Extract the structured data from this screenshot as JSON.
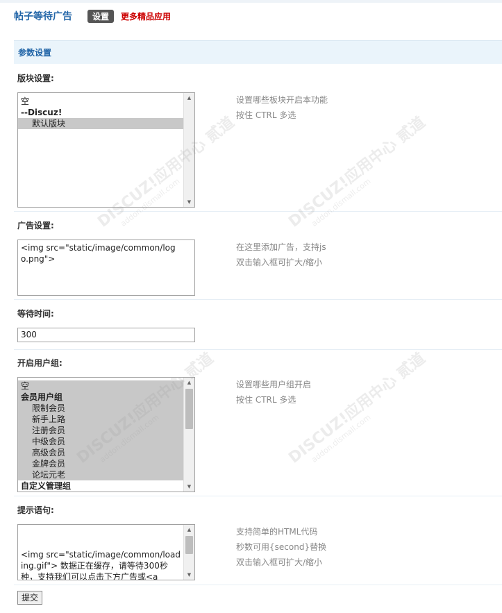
{
  "header": {
    "app_title": "帖子等待广告",
    "settings_tab": "设置",
    "more_apps_link": "更多精品应用"
  },
  "section": {
    "title": "参数设置"
  },
  "forum_setting": {
    "label": "版块设置:",
    "options": [
      {
        "text": "空",
        "type": "plain",
        "selected": false
      },
      {
        "text": "--Discuz!",
        "type": "group",
        "selected": false
      },
      {
        "text": "默认版块",
        "type": "indent",
        "selected": true
      }
    ],
    "tip_line1": "设置哪些板块开启本功能",
    "tip_line2": "按住 CTRL 多选"
  },
  "ad_setting": {
    "label": "广告设置:",
    "value": "<img src=\"static/image/common/logo.png\">",
    "tip_line1": "在这里添加广告，支持js",
    "tip_line2": "双击输入框可扩大/缩小"
  },
  "wait_time": {
    "label": "等待时间:",
    "value": "300"
  },
  "user_groups": {
    "label": "开启用户组:",
    "options": [
      {
        "text": "空",
        "type": "plain",
        "selected": true
      },
      {
        "text": "会员用户组",
        "type": "group",
        "selected": true
      },
      {
        "text": "限制会员",
        "type": "indent",
        "selected": true
      },
      {
        "text": "新手上路",
        "type": "indent",
        "selected": true
      },
      {
        "text": "注册会员",
        "type": "indent",
        "selected": true
      },
      {
        "text": "中级会员",
        "type": "indent",
        "selected": true
      },
      {
        "text": "高级会员",
        "type": "indent",
        "selected": true
      },
      {
        "text": "金牌会员",
        "type": "indent",
        "selected": true
      },
      {
        "text": "论坛元老",
        "type": "indent",
        "selected": true
      },
      {
        "text": "自定义管理组",
        "type": "group",
        "selected": false
      }
    ],
    "tip_line1": "设置哪些用户组开启",
    "tip_line2": "按住 CTRL 多选"
  },
  "prompt": {
    "label": "提示语句:",
    "value": "<img src=\"static/image/common/loading.gif\"> 数据正在缓存，请等待300秒种，支持我们可以点击下方广告或<a",
    "tip_line1": "支持简单的HTML代码",
    "tip_line2": "秒数可用{second}替换",
    "tip_line3": "双击输入框可扩大/缩小"
  },
  "submit_label": "提交",
  "watermark": {
    "brand": "DISCUZ!应用中心",
    "domain": "addon.dismall.com",
    "mark": "贰道"
  }
}
